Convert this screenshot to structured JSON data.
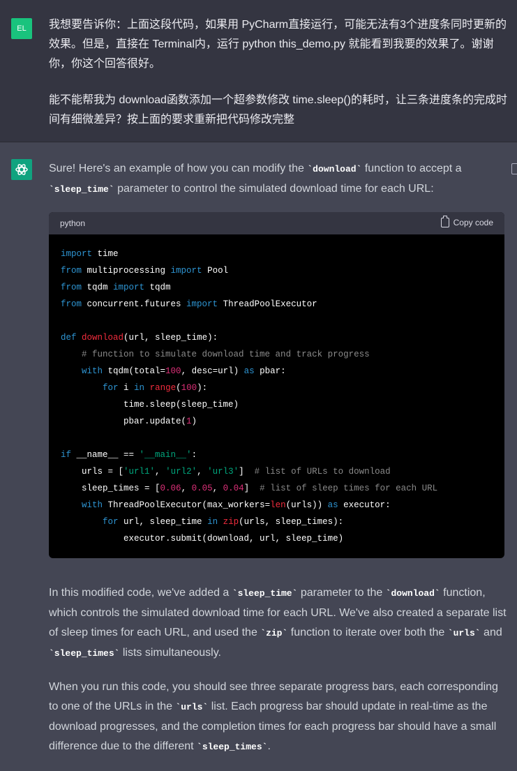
{
  "user": {
    "avatar": "EL",
    "para1": "我想要告诉你：上面这段代码，如果用 PyCharm直接运行，可能无法有3个进度条同时更新的效果。但是，直接在 Terminal内，运行 python this_demo.py 就能看到我要的效果了。谢谢你，你这个回答很好。",
    "para2": "能不能帮我为 download函数添加一个超参数修改 time.sleep()的耗时，让三条进度条的完成时间有细微差异？按上面的要求重新把代码修改完整"
  },
  "assistant": {
    "intro_1": "Sure! Here's an example of how you can modify the ",
    "intro_code1": "`download`",
    "intro_2": " function to accept a ",
    "intro_code2": "`sleep_time`",
    "intro_3": " parameter to control the simulated download time for each URL:",
    "code_block": {
      "language": "python",
      "copy_label": "Copy code"
    },
    "p2_1": "In this modified code, we've added a ",
    "p2_code1": "`sleep_time`",
    "p2_2": " parameter to the ",
    "p2_code2": "`download`",
    "p2_3": " function, which controls the simulated download time for each URL. We've also created a separate list of sleep times for each URL, and used the ",
    "p2_code3": "`zip`",
    "p2_4": " function to iterate over both the ",
    "p2_code4": "`urls`",
    "p2_5": " and ",
    "p2_code5": "`sleep_times`",
    "p2_6": " lists simultaneously.",
    "p3_1": "When you run this code, you should see three separate progress bars, each corresponding to one of the URLs in the ",
    "p3_code1": "`urls`",
    "p3_2": " list. Each progress bar should update in real-time as the download progresses, and the completion times for each progress bar should have a small difference due to the different ",
    "p3_code2": "`sleep_times`",
    "p3_3": "."
  },
  "code": {
    "l1_kw": "import",
    "l1_rest": " time",
    "l2_kw1": "from",
    "l2_mid": " multiprocessing ",
    "l2_kw2": "import",
    "l2_rest": " Pool",
    "l3_kw1": "from",
    "l3_mid": " tqdm ",
    "l3_kw2": "import",
    "l3_rest": " tqdm",
    "l4_kw1": "from",
    "l4_mid": " concurrent.futures ",
    "l4_kw2": "import",
    "l4_rest": " ThreadPoolExecutor",
    "l6_kw": "def",
    "l6_fn": "download",
    "l6_rest": "(url, sleep_time):",
    "l7_cm": "# function to simulate download time and track progress",
    "l8_kw": "with",
    "l8_a": " tqdm(total=",
    "l8_num": "100",
    "l8_b": ", desc=url) ",
    "l8_kw2": "as",
    "l8_c": " pbar:",
    "l9_kw": "for",
    "l9_a": " i ",
    "l9_kw2": "in",
    "l9_fn": " range",
    "l9_b": "(",
    "l9_num": "100",
    "l9_c": "):",
    "l10": "time.sleep(sleep_time)",
    "l11_a": "pbar.update(",
    "l11_num": "1",
    "l11_b": ")",
    "l13_kw": "if",
    "l13_a": " __name__ == ",
    "l13_str": "'__main__'",
    "l13_b": ":",
    "l14_a": "urls = [",
    "l14_s1": "'url1'",
    "l14_b": ", ",
    "l14_s2": "'url2'",
    "l14_c": ", ",
    "l14_s3": "'url3'",
    "l14_d": "]  ",
    "l14_cm": "# list of URLs to download",
    "l15_a": "sleep_times = [",
    "l15_n1": "0.06",
    "l15_b": ", ",
    "l15_n2": "0.05",
    "l15_c": ", ",
    "l15_n3": "0.04",
    "l15_d": "]  ",
    "l15_cm": "# list of sleep times for each URL",
    "l16_kw": "with",
    "l16_a": " ThreadPoolExecutor(max_workers=",
    "l16_fn": "len",
    "l16_b": "(urls)) ",
    "l16_kw2": "as",
    "l16_c": " executor:",
    "l17_kw": "for",
    "l17_a": " url, sleep_time ",
    "l17_kw2": "in",
    "l17_fn": " zip",
    "l17_b": "(urls, sleep_times):",
    "l18": "executor.submit(download, url, sleep_time)"
  }
}
